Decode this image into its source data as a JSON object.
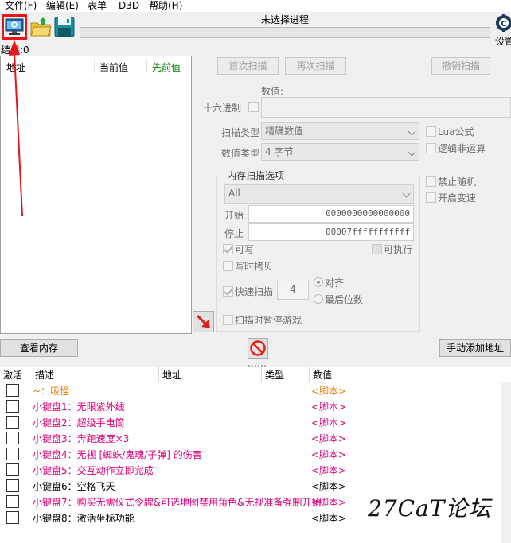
{
  "menu": [
    "文件(F)",
    "编辑(E)",
    "表单",
    "D3D",
    "帮助(H)"
  ],
  "toolbar": {
    "process_title": "未选择进程",
    "settings_label": "设置",
    "icons": [
      "computer-process-icon",
      "open-folder-icon",
      "save-floppy-icon"
    ]
  },
  "results": {
    "label": "结果:0"
  },
  "left_list": {
    "col_address": "地址",
    "col_current": "当前值",
    "col_previous": "先前值"
  },
  "scan": {
    "first_scan": "首次扫描",
    "next_scan": "再次扫描",
    "undo_scan": "撤销扫描",
    "value_label": "数值:",
    "hex_label": "十六进制",
    "scan_type_label": "扫描类型",
    "scan_type_value": "精确数值",
    "value_type_label": "数值类型",
    "value_type_value": "4 字节",
    "lua_formula": "Lua公式",
    "logic_not": "逻辑非运算",
    "mem_options_title": "内存扫描选项",
    "region_value": "All",
    "start_label": "开始",
    "start_value": "0000000000000000",
    "stop_label": "停止",
    "stop_value": "00007fffffffffff",
    "writable": "可写",
    "executable": "可执行",
    "copy_on_write": "写时拷贝",
    "fast_scan": "快速扫描",
    "fast_scan_value": "4",
    "align": "对齐",
    "last_digits": "最后位数",
    "pause_game": "扫描时暂停游戏",
    "disable_random": "禁止随机",
    "speedhack": "开启变速"
  },
  "actions": {
    "view_memory": "查看内存",
    "add_address": "手动添加地址"
  },
  "table": {
    "headers": {
      "active": "激活",
      "description": "描述",
      "address": "地址",
      "type": "类型",
      "value": "数值"
    },
    "rows": [
      {
        "desc": "~：吸怪",
        "value": "<脚本>",
        "color": "#f07c00"
      },
      {
        "desc": "小键盘1：无限紫外线",
        "value": "<脚本>",
        "color": "#e0007a"
      },
      {
        "desc": "小键盘2：超级手电筒",
        "value": "<脚本>",
        "color": "#e0007a"
      },
      {
        "desc": "小键盘3：奔跑速度×3",
        "value": "<脚本>",
        "color": "#e0007a"
      },
      {
        "desc": "小键盘4：无视 [蜘蛛/鬼魂/子弹] 的伤害",
        "value": "<脚本>",
        "color": "#e0007a"
      },
      {
        "desc": "小键盘5：交互动作立即完成",
        "value": "<脚本>",
        "color": "#e0007a"
      },
      {
        "desc": "小键盘6：空格飞天",
        "value": "<脚本>",
        "color": "#000000"
      },
      {
        "desc": "小键盘7：购买无需仪式令牌&可选地图禁用角色&无视准备强制开始",
        "value": "<脚本>",
        "color": "#e0007a"
      },
      {
        "desc": "小键盘8：激活坐标功能",
        "value": "<脚本>",
        "color": "#000000"
      }
    ]
  },
  "watermark": "27CaT论坛",
  "colors": {
    "highlight": "#e8161b",
    "prev_value_green": "#008000",
    "script_red": "#e0007a",
    "orange": "#f07c00"
  }
}
